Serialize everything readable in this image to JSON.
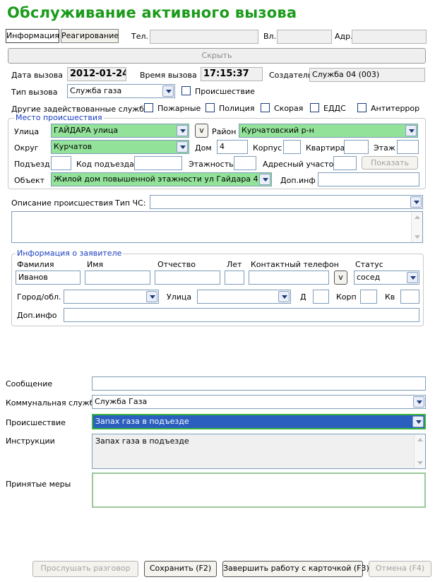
{
  "title": "Обслуживание активного вызова",
  "tabs": {
    "info": "Информация",
    "response": "Реагирование"
  },
  "header_fields": {
    "tel_label": "Тел.",
    "vl_label": "Вл.",
    "adr_label": "Адр."
  },
  "hide_button": "Скрыть",
  "call": {
    "date_label": "Дата вызова",
    "date": "2012-01-24",
    "time_label": "Время вызова",
    "time": "17:15:37",
    "creator_label": "Создатель",
    "creator": "Служба 04 (003)",
    "type_label": "Тип вызова",
    "type": "Служба газа",
    "incident_label": "Происшествие"
  },
  "other_services": {
    "label": "Другие задействованные службы:",
    "items": [
      "Пожарные",
      "Полиция",
      "Скорая",
      "ЕДДС",
      "Антитеррор"
    ]
  },
  "location": {
    "legend": "Место происшествия",
    "street_label": "Улица",
    "street": "ГАЙДАРА улица",
    "v_button": "v",
    "district_label": "Район",
    "district": "Курчатовский р-н",
    "okrug_label": "Округ",
    "okrug": "Курчатов",
    "house_label": "Дом",
    "house": "4",
    "korpus_label": "Корпус",
    "apartment_label": "Квартира",
    "floor_label": "Этаж",
    "entrance_label": "Подъезд",
    "entrance_code_label": "Код подъезда",
    "floors_label": "Этажность",
    "address_section_label": "Адресный участок",
    "show_button": "Показать",
    "object_label": "Объект",
    "object": "Жилой дом повышенной этажности ул Гайдара 4",
    "extra_label": "Доп.инф"
  },
  "description": {
    "label": "Описание происшествия",
    "chs_type_label": "Тип ЧС:"
  },
  "applicant": {
    "legend": "Информация о заявителе",
    "surname_label": "Фамилия",
    "surname": "Иванов",
    "name_label": "Имя",
    "patronymic_label": "Отчество",
    "age_label": "Лет",
    "phone_label": "Контактный телефон",
    "v_button": "v",
    "status_label": "Статус",
    "status": "сосед",
    "city_label": "Город/обл.",
    "street_label": "Улица",
    "house_label": "Д",
    "korp_label": "Корп",
    "kv_label": "Кв",
    "extra_label": "Доп.инфо"
  },
  "bottom": {
    "message_label": "Сообщение",
    "utility_label": "Коммунальная служба",
    "utility": "Служба Газа",
    "incident_label": "Происшествие",
    "incident": "Запах газа в подъезде",
    "instructions_label": "Инструкции",
    "instructions": "Запах газа в подъезде",
    "measures_label": "Принятые меры"
  },
  "buttons": {
    "listen": "Прослушать разговор",
    "save": "Сохранить (F2)",
    "finish": "Завершить работу с карточкой (F3)",
    "cancel": "Отмена (F4)"
  }
}
